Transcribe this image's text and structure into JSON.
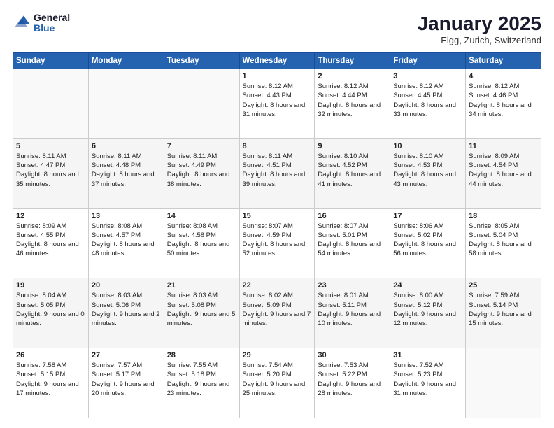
{
  "header": {
    "logo_general": "General",
    "logo_blue": "Blue",
    "title": "January 2025",
    "subtitle": "Elgg, Zurich, Switzerland"
  },
  "calendar": {
    "days_of_week": [
      "Sunday",
      "Monday",
      "Tuesday",
      "Wednesday",
      "Thursday",
      "Friday",
      "Saturday"
    ],
    "weeks": [
      [
        {
          "day": "",
          "info": ""
        },
        {
          "day": "",
          "info": ""
        },
        {
          "day": "",
          "info": ""
        },
        {
          "day": "1",
          "sunrise": "8:12 AM",
          "sunset": "4:43 PM",
          "daylight": "8 hours and 31 minutes."
        },
        {
          "day": "2",
          "sunrise": "8:12 AM",
          "sunset": "4:44 PM",
          "daylight": "8 hours and 32 minutes."
        },
        {
          "day": "3",
          "sunrise": "8:12 AM",
          "sunset": "4:45 PM",
          "daylight": "8 hours and 33 minutes."
        },
        {
          "day": "4",
          "sunrise": "8:12 AM",
          "sunset": "4:46 PM",
          "daylight": "8 hours and 34 minutes."
        }
      ],
      [
        {
          "day": "5",
          "sunrise": "8:11 AM",
          "sunset": "4:47 PM",
          "daylight": "8 hours and 35 minutes."
        },
        {
          "day": "6",
          "sunrise": "8:11 AM",
          "sunset": "4:48 PM",
          "daylight": "8 hours and 37 minutes."
        },
        {
          "day": "7",
          "sunrise": "8:11 AM",
          "sunset": "4:49 PM",
          "daylight": "8 hours and 38 minutes."
        },
        {
          "day": "8",
          "sunrise": "8:11 AM",
          "sunset": "4:51 PM",
          "daylight": "8 hours and 39 minutes."
        },
        {
          "day": "9",
          "sunrise": "8:10 AM",
          "sunset": "4:52 PM",
          "daylight": "8 hours and 41 minutes."
        },
        {
          "day": "10",
          "sunrise": "8:10 AM",
          "sunset": "4:53 PM",
          "daylight": "8 hours and 43 minutes."
        },
        {
          "day": "11",
          "sunrise": "8:09 AM",
          "sunset": "4:54 PM",
          "daylight": "8 hours and 44 minutes."
        }
      ],
      [
        {
          "day": "12",
          "sunrise": "8:09 AM",
          "sunset": "4:55 PM",
          "daylight": "8 hours and 46 minutes."
        },
        {
          "day": "13",
          "sunrise": "8:08 AM",
          "sunset": "4:57 PM",
          "daylight": "8 hours and 48 minutes."
        },
        {
          "day": "14",
          "sunrise": "8:08 AM",
          "sunset": "4:58 PM",
          "daylight": "8 hours and 50 minutes."
        },
        {
          "day": "15",
          "sunrise": "8:07 AM",
          "sunset": "4:59 PM",
          "daylight": "8 hours and 52 minutes."
        },
        {
          "day": "16",
          "sunrise": "8:07 AM",
          "sunset": "5:01 PM",
          "daylight": "8 hours and 54 minutes."
        },
        {
          "day": "17",
          "sunrise": "8:06 AM",
          "sunset": "5:02 PM",
          "daylight": "8 hours and 56 minutes."
        },
        {
          "day": "18",
          "sunrise": "8:05 AM",
          "sunset": "5:04 PM",
          "daylight": "8 hours and 58 minutes."
        }
      ],
      [
        {
          "day": "19",
          "sunrise": "8:04 AM",
          "sunset": "5:05 PM",
          "daylight": "9 hours and 0 minutes."
        },
        {
          "day": "20",
          "sunrise": "8:03 AM",
          "sunset": "5:06 PM",
          "daylight": "9 hours and 2 minutes."
        },
        {
          "day": "21",
          "sunrise": "8:03 AM",
          "sunset": "5:08 PM",
          "daylight": "9 hours and 5 minutes."
        },
        {
          "day": "22",
          "sunrise": "8:02 AM",
          "sunset": "5:09 PM",
          "daylight": "9 hours and 7 minutes."
        },
        {
          "day": "23",
          "sunrise": "8:01 AM",
          "sunset": "5:11 PM",
          "daylight": "9 hours and 10 minutes."
        },
        {
          "day": "24",
          "sunrise": "8:00 AM",
          "sunset": "5:12 PM",
          "daylight": "9 hours and 12 minutes."
        },
        {
          "day": "25",
          "sunrise": "7:59 AM",
          "sunset": "5:14 PM",
          "daylight": "9 hours and 15 minutes."
        }
      ],
      [
        {
          "day": "26",
          "sunrise": "7:58 AM",
          "sunset": "5:15 PM",
          "daylight": "9 hours and 17 minutes."
        },
        {
          "day": "27",
          "sunrise": "7:57 AM",
          "sunset": "5:17 PM",
          "daylight": "9 hours and 20 minutes."
        },
        {
          "day": "28",
          "sunrise": "7:55 AM",
          "sunset": "5:18 PM",
          "daylight": "9 hours and 23 minutes."
        },
        {
          "day": "29",
          "sunrise": "7:54 AM",
          "sunset": "5:20 PM",
          "daylight": "9 hours and 25 minutes."
        },
        {
          "day": "30",
          "sunrise": "7:53 AM",
          "sunset": "5:22 PM",
          "daylight": "9 hours and 28 minutes."
        },
        {
          "day": "31",
          "sunrise": "7:52 AM",
          "sunset": "5:23 PM",
          "daylight": "9 hours and 31 minutes."
        },
        {
          "day": "",
          "info": ""
        }
      ]
    ]
  }
}
